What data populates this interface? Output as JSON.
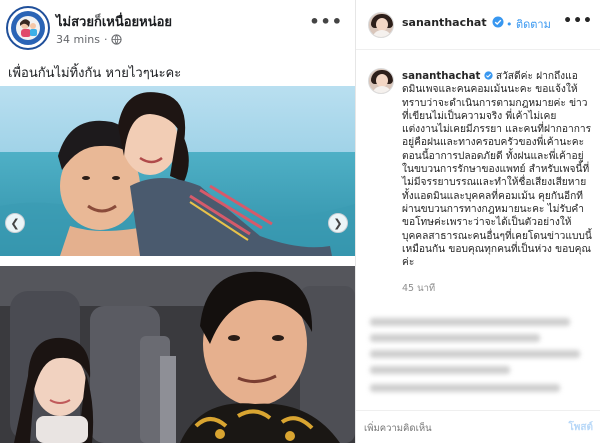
{
  "facebook_post": {
    "page_name": "ไม่สวยก็เหนื่อยหน่อย",
    "timestamp": "34 mins",
    "dot_separator": "·",
    "caption": "เพื่อนกันไม่ทิ้งกัน หายไวๆนะคะ",
    "more_icon": "more-horizontal-icon",
    "privacy_icon": "globe-icon"
  },
  "instagram_post": {
    "username": "sananthachat",
    "verified_icon": "verified-badge-icon",
    "follow_label": "• ติดตาม",
    "caption_username": "sananthachat",
    "caption_text": "สวัสดีค่ะ ฝากถึงแอดมินเพจและคนคอมเม้นนะคะ ขอแจ้งให้ทราบว่าจะดำเนินการตามกฎหมายค่ะ ข่าวที่เขียนไม่เป็นความจริง พี่เค้าไม่เคยแต่งงานไม่เคยมีภรรยา และคนที่ฝากอาการอยู่คือฝนและทางครอบครัวของพี่เค้านะคะ ตอนนี้อาการปลอดภัยดี ทั้งฝนและพี่เค้าอยู่ในขบวนการรักษาของแพทย์ สำหรับเพจนี้ที่ไม่มีจรรยาบรรณและทำให้ชื่อเสียงเสียหาย ทั้งแอดมินและบุคคลที่คอมเม้น คุยกันอีกทีผ่านขบวนการทางกฎหมายนะคะ ไม่รับคำขอโทษค่ะเพราะว่าจะได้เป็นตัวอย่างให้บุคคลสาธารณะคนอื่นๆที่เคยโดนข่าวแบบนี้เหมือนกัน ขอบคุณทุกคนที่เป็นห่วง ขอบคุณค่ะ",
    "time_ago": "45 นาที",
    "comment_placeholder": "เพิ่มความคิดเห็น",
    "post_label": "โพสต์"
  },
  "colors": {
    "fb_text": "#1c1e21",
    "fb_meta": "#65676b",
    "ig_link": "#3897f0",
    "ig_text": "#262626",
    "ig_muted": "#8e8e8e",
    "verified": "#3897f0"
  }
}
